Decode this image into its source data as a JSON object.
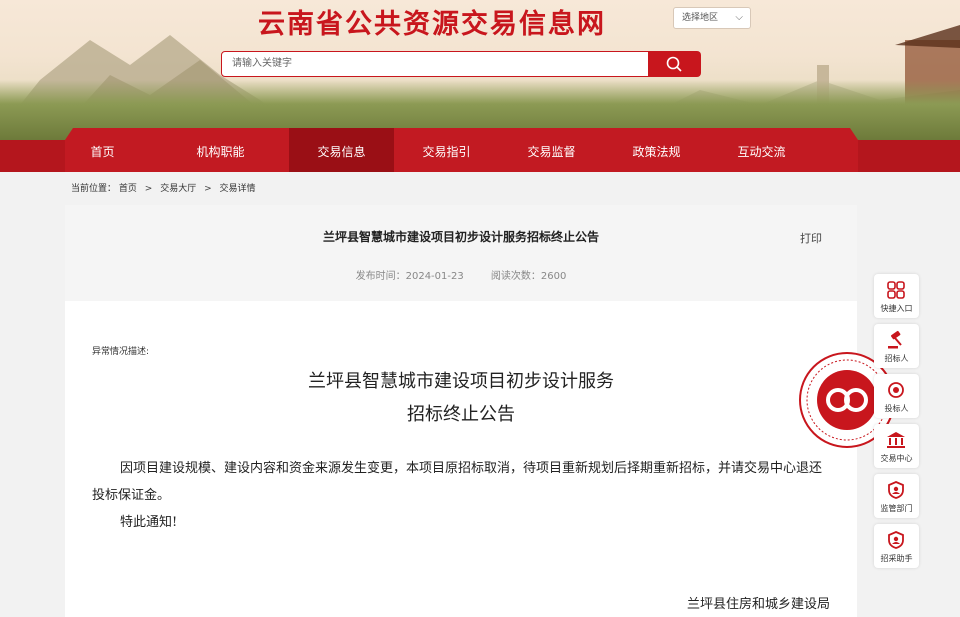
{
  "header": {
    "site_title": "云南省公共资源交易信息网",
    "region_select": {
      "selected": "选择地区"
    },
    "search": {
      "placeholder": "请输入关键字"
    }
  },
  "nav": {
    "items": [
      {
        "label": "首页",
        "active": false
      },
      {
        "label": "机构职能",
        "active": false
      },
      {
        "label": "交易信息",
        "active": true
      },
      {
        "label": "交易指引",
        "active": false
      },
      {
        "label": "交易监督",
        "active": false
      },
      {
        "label": "政策法规",
        "active": false
      },
      {
        "label": "互动交流",
        "active": false
      }
    ]
  },
  "breadcrumb": {
    "prefix": "当前位置：",
    "items": [
      "首页",
      "交易大厅",
      "交易详情"
    ]
  },
  "article": {
    "title": "兰坪县智慧城市建设项目初步设计服务招标终止公告",
    "print_label": "打印",
    "publish_time": "发布时间：2024-01-23",
    "view_count": "阅读次数：2600",
    "abnormal_label": "异常情况描述:",
    "doc_title_line1": "兰坪县智慧城市建设项目初步设计服务",
    "doc_title_line2": "招标终止公告",
    "paragraph1": "因项目建设规模、建设内容和资金来源发生变更，本项目原招标取消，待项目重新规划后择期重新招标，并请交易中心退还投标保证金。",
    "paragraph2": "特此通知!",
    "signer": "兰坪县住房和城乡建设局"
  },
  "sidebar": {
    "items": [
      {
        "label": "快捷入口",
        "icon": "grid-icon"
      },
      {
        "label": "招标人",
        "icon": "gavel-icon"
      },
      {
        "label": "投标人",
        "icon": "target-icon"
      },
      {
        "label": "交易中心",
        "icon": "bank-icon"
      },
      {
        "label": "监管部门",
        "icon": "shield-icon"
      },
      {
        "label": "招采助手",
        "icon": "helper-icon"
      }
    ]
  },
  "colors": {
    "brand_red": "#c8161d",
    "nav_active": "#9a0f15"
  }
}
